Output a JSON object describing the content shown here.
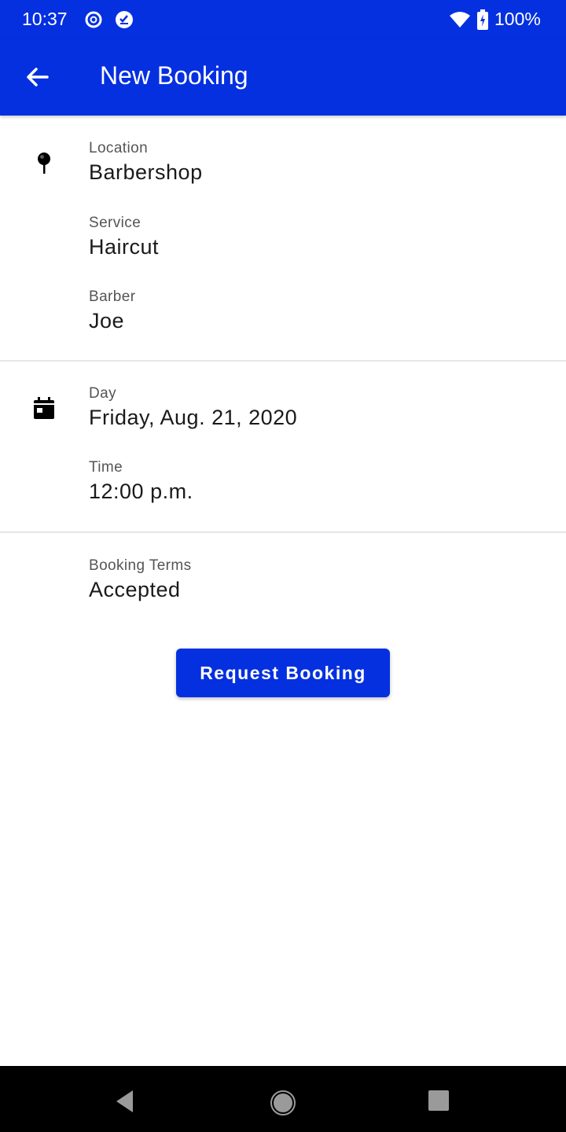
{
  "status_bar": {
    "time": "10:37",
    "battery": "100%",
    "icons": [
      "data-saver-icon",
      "task-check-icon",
      "wifi-icon",
      "battery-charging-icon"
    ]
  },
  "app_bar": {
    "title": "New Booking",
    "back_icon": "arrow-left-icon"
  },
  "sections": {
    "place": {
      "icon": "pushpin-icon",
      "fields": [
        {
          "label": "Location",
          "value": "Barbershop"
        },
        {
          "label": "Service",
          "value": "Haircut"
        },
        {
          "label": "Barber",
          "value": "Joe"
        }
      ]
    },
    "schedule": {
      "icon": "calendar-icon",
      "fields": [
        {
          "label": "Day",
          "value": "Friday, Aug. 21, 2020"
        },
        {
          "label": "Time",
          "value": "12:00 p.m."
        }
      ]
    },
    "terms": {
      "fields": [
        {
          "label": "Booking Terms",
          "value": "Accepted"
        }
      ]
    }
  },
  "actions": {
    "request_label": "Request Booking"
  },
  "colors": {
    "primary": "#0530E0",
    "text": "#1a1a1a",
    "label": "#555555"
  },
  "nav_bar": {
    "buttons": [
      "back",
      "home",
      "recents"
    ]
  }
}
